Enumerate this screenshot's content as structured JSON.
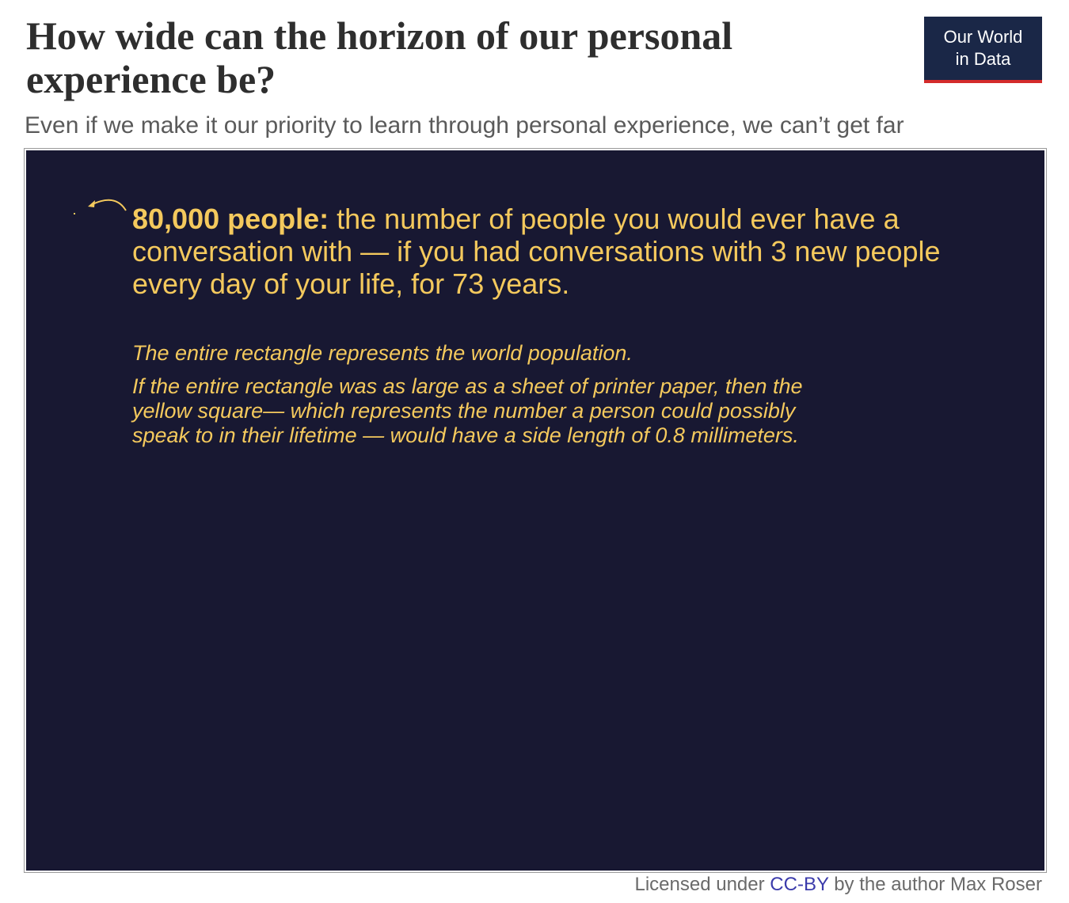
{
  "title": "How wide can the horizon of our personal experience be?",
  "subtitle": "Even if we make it our priority to learn through personal experience, we can’t get far",
  "logo": {
    "line1": "Our World",
    "line2": "in Data"
  },
  "panel": {
    "headline_bold": "80,000 people:",
    "headline_rest": " the number of people you would ever have a conversation with — if you had conversations with 3 new people every day of your life, for 73 years.",
    "note1": "The entire rectangle represents the world population.",
    "note2": "If the entire rectangle was as large as a sheet of printer paper, then the yellow square— which represents the number a person could possibly speak to in their lifetime — would have a side length of 0.8 millimeters."
  },
  "footer": {
    "prefix": "Licensed under ",
    "link": "CC-BY",
    "suffix": " by the author Max Roser"
  },
  "colors": {
    "panel_background": "#181832",
    "highlight_yellow": "#f4c95d",
    "logo_background": "#1a2747",
    "logo_accent": "#d42b2b",
    "link": "#3b3bab"
  }
}
